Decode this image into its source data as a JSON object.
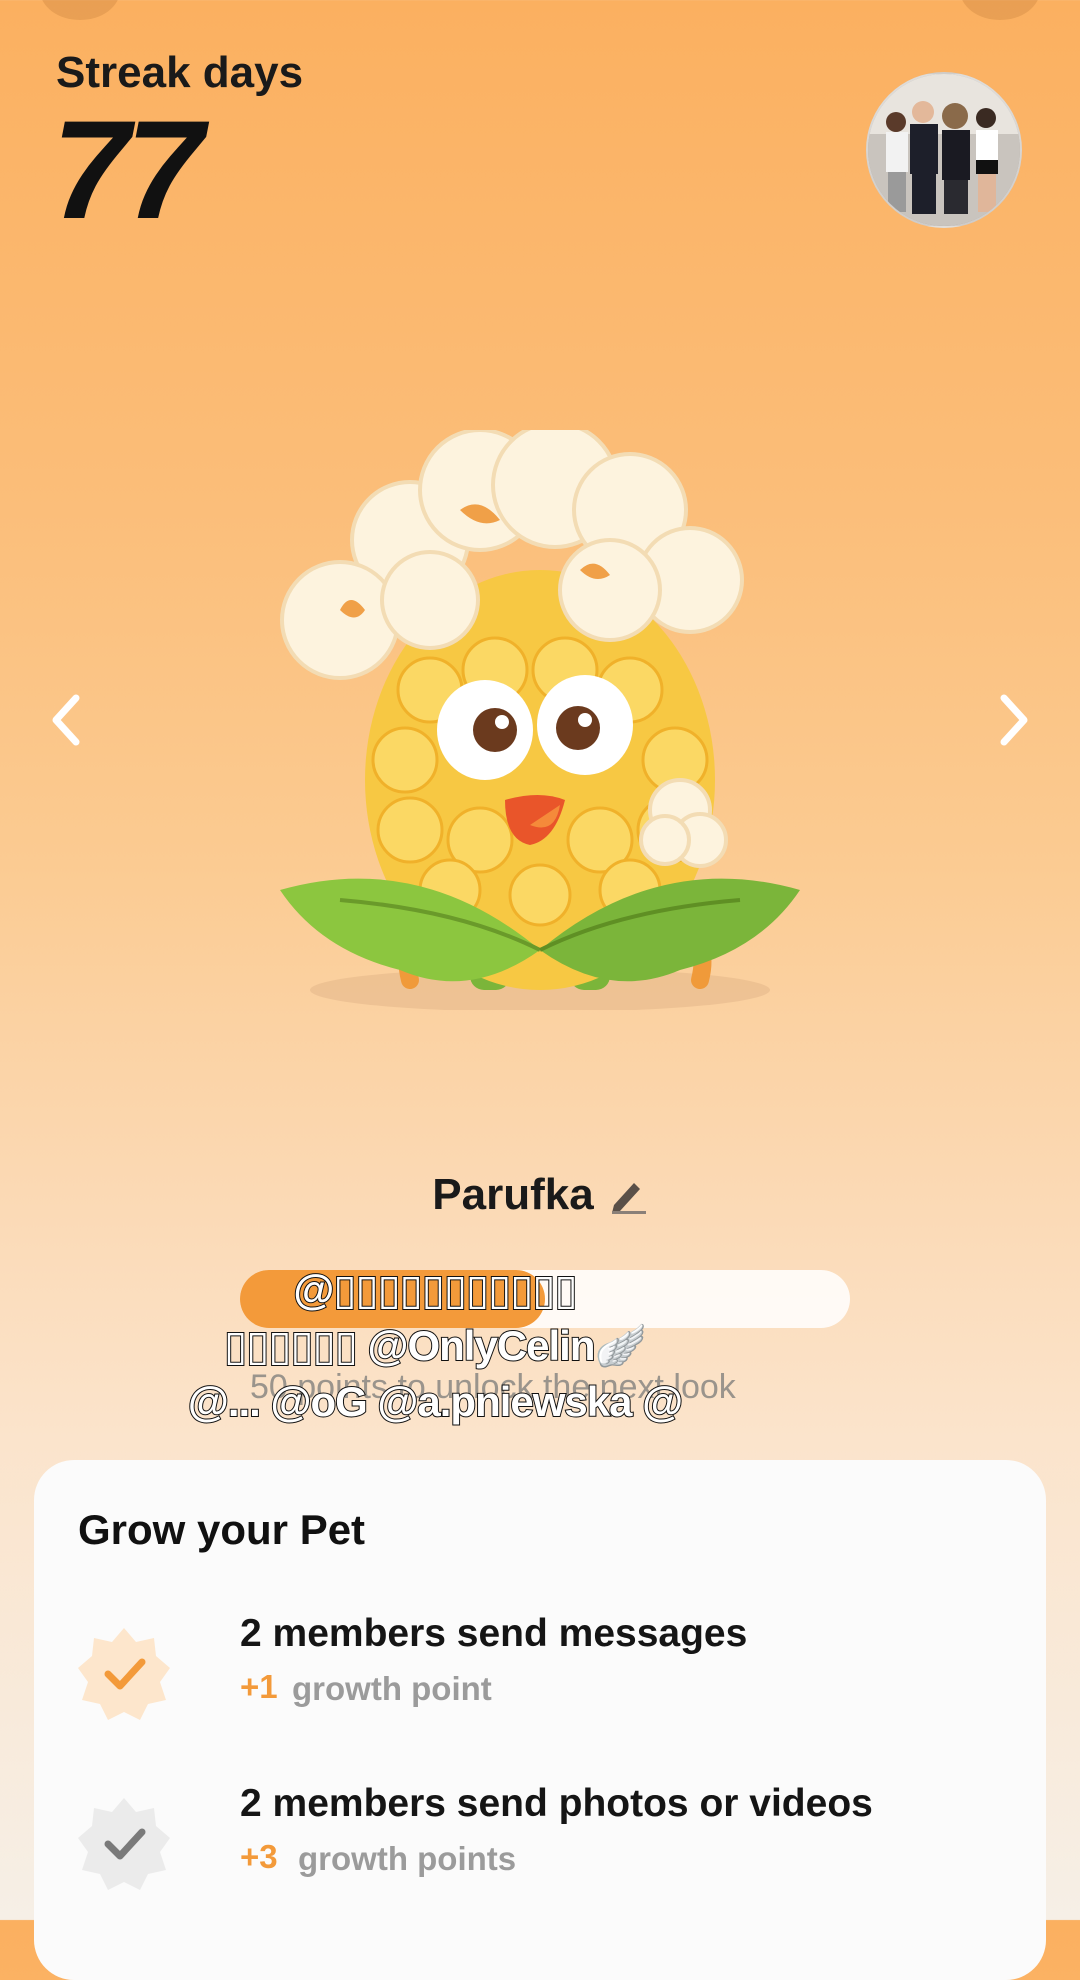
{
  "header": {
    "streak_label": "Streak days",
    "streak_value": "77"
  },
  "pet": {
    "name": "Parufka",
    "progress_fraction": 0.5,
    "unlock_text": "50 points to unlock the next look"
  },
  "overlay": {
    "lines": [
      "@▯▯▯▯▯▯▯▯▯▯▯",
      "▯▯▯▯▯▯ @OnlyCelin🪽",
      "@... @oG @a.pniewska @"
    ]
  },
  "grow_card": {
    "title": "Grow your Pet",
    "tasks": [
      {
        "title": "2 members send messages",
        "points": "+1",
        "label": "growth point",
        "completed": true
      },
      {
        "title": "2 members send photos or videos",
        "points": "+3",
        "label": "growth points",
        "completed": false
      }
    ]
  },
  "colors": {
    "accent": "#f39a3a",
    "background_top": "#fbb060",
    "card": "#fbfbfb"
  },
  "icons": [
    "chevron-left-icon",
    "chevron-right-icon",
    "edit-pencil-icon",
    "check-badge-icon"
  ]
}
